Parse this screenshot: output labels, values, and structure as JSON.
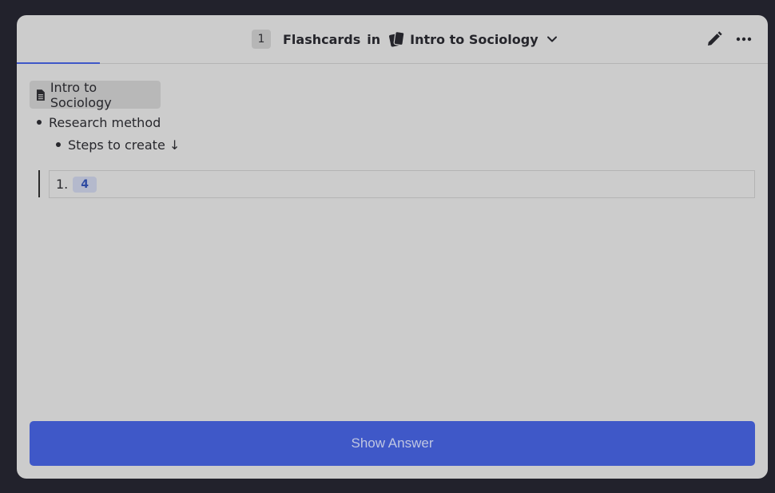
{
  "header": {
    "count": "1",
    "flashcards_label": "Flashcards",
    "in_label": "in",
    "deck_name": "Intro to Sociology",
    "deck_icon": "cards-icon",
    "edit_icon": "pencil-icon",
    "more_icon": "ellipsis-icon"
  },
  "breadcrumb": {
    "document": "Intro to Sociology",
    "level1": "Research method",
    "level2": "Steps to create ↓"
  },
  "card": {
    "prefix": "1.",
    "cloze": "4"
  },
  "footer": {
    "show_answer_label": "Show Answer"
  },
  "colors": {
    "accent": "#3f58c8",
    "panel": "#cccccc",
    "background": "#22222c"
  }
}
